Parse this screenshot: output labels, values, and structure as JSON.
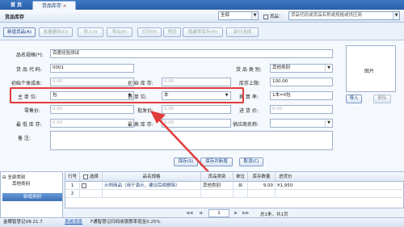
{
  "tabs": {
    "home": "首 页",
    "active": "货品库存",
    "close": "✕"
  },
  "title": "货品库存",
  "filters": {
    "scope_value": "全部",
    "goods_label": "货品：",
    "goods_placeholder": "货品代码或货品名称或规格或供应商"
  },
  "toolbar": {
    "buttons": [
      "新增货品(A)",
      "批量删除(D)",
      "导入(I)",
      "导出(E)",
      "打印(P)",
      "预览",
      "隐藏零库存(H)",
      "部分选择"
    ]
  },
  "form": {
    "name_label": "品名规格(*):",
    "name_value": "百度经验测试",
    "code_label": "货 品 代 码:",
    "code_value": "0001",
    "init_cost_label": "初始个体成本:",
    "init_cost_value": "0.00",
    "init_stock_label": "初 始 库 存:",
    "init_stock_value": "0.00",
    "category_label": "货 品 类 别:",
    "category_value": "其他类别",
    "stock_limit_label": "库存上限:",
    "stock_limit_value": "100.00",
    "unit_label": "主  单  位:",
    "unit_value": "包",
    "sale_unit_label": "销 单 位:",
    "sale_unit_value": "本",
    "convert_label": "换 算 率:",
    "convert_value": "1本=0包",
    "retail_label": "零售价:",
    "retail_value": "0.00",
    "wholesale_label": "批发价:",
    "wholesale_value": "0.00",
    "purchase_label": "进 货 价:",
    "purchase_value": "0.00",
    "min_stock_label": "最 低 库 存:",
    "min_stock_value": "0.00",
    "max_stock_label": "最 高 库 存:",
    "max_stock_value": "0.00",
    "supplier_label": "供应商名称:",
    "supplier_value": "",
    "note_label": "备      注:",
    "picture_label": "图片",
    "import_btn": "导入",
    "delete_btn": "删除",
    "save_btn": "保存(S)",
    "save_new_btn": "保存并新增",
    "cancel_btn": "取消(C)"
  },
  "tree": {
    "root": "全部类别",
    "child": "其他类别",
    "new_btn": "新增类别"
  },
  "grid": {
    "headers": [
      "行号",
      "选择",
      "品名规格",
      "货品类别",
      "单位",
      "库存数量",
      "进货价"
    ],
    "rows": [
      {
        "no": "1",
        "name": "示例商品（用于演示，建议后续删除）",
        "category": "其他类别",
        "unit": "台",
        "qty": "9.00",
        "price": "¥1,950"
      },
      {
        "no": "2",
        "name": "",
        "category": "",
        "unit": "",
        "qty": "",
        "price": ""
      }
    ]
  },
  "pager": {
    "first": "◀◀",
    "prev": "◀",
    "page_value": "1",
    "next": "▶",
    "last": "▶▶",
    "total": "总1条，共1页"
  },
  "status": {
    "app": "金蝶智慧记V8.21.7",
    "msg_label": "系统消息",
    "message": "F通智慧记扫码收银惠率低至0.25%"
  },
  "colors": {
    "highlight": "#e23b3b",
    "accent": "#2a5fa8"
  }
}
